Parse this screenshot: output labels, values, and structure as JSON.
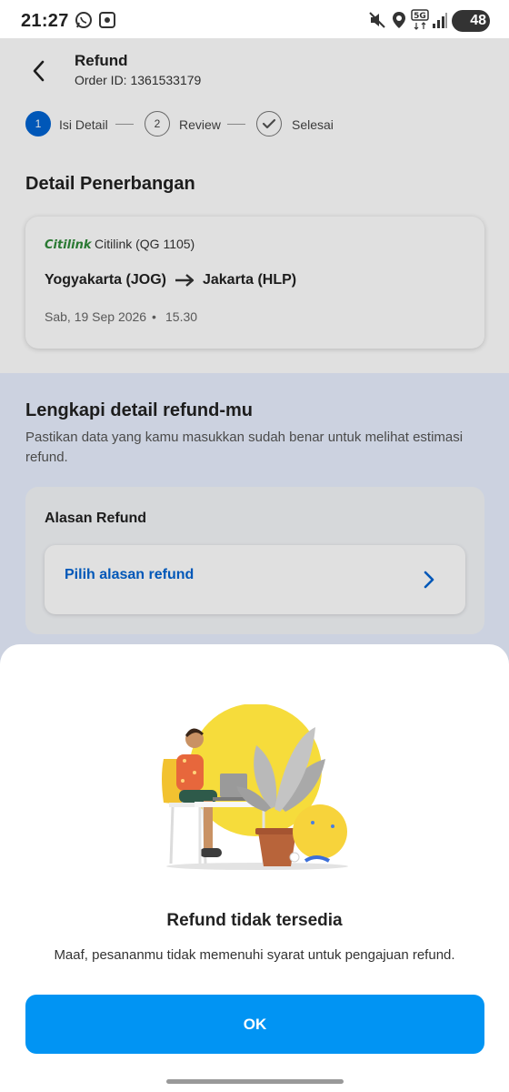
{
  "status_bar": {
    "time": "21:27",
    "battery": "48",
    "network": "5G",
    "icons": [
      "whatsapp-icon",
      "screenshot-icon",
      "mute-icon",
      "location-icon",
      "5g-icon",
      "signal-icon",
      "battery-icon"
    ]
  },
  "header": {
    "title": "Refund",
    "order_id": "Order ID: 1361533179"
  },
  "stepper": {
    "steps": [
      {
        "number": "1",
        "label": "Isi Detail",
        "state": "active"
      },
      {
        "number": "2",
        "label": "Review",
        "state": "inactive"
      },
      {
        "number": "",
        "label": "Selesai",
        "state": "check"
      }
    ]
  },
  "flight": {
    "section_title": "Detail Penerbangan",
    "airline_logo": "Citilink",
    "airline": "Citilink (QG 1105)",
    "origin": "Yogyakarta (JOG)",
    "destination": "Jakarta (HLP)",
    "date": "Sab, 19 Sep 2026",
    "separator": "•",
    "time": "15.30"
  },
  "refund": {
    "title": "Lengkapi detail refund-mu",
    "description": "Pastikan data yang kamu masukkan sudah benar untuk melihat estimasi refund.",
    "reason_title": "Alasan Refund",
    "reason_placeholder": "Pilih alasan refund"
  },
  "dialog": {
    "title": "Refund tidak tersedia",
    "message": "Maaf, pesananmu tidak memenuhi syarat untuk pengajuan refund.",
    "ok_label": "OK"
  },
  "colors": {
    "primary_button": "#0194f3",
    "step_active": "#0064d2",
    "link": "#0064d2",
    "refund_section_bg": "#e9f0ff",
    "illustration_sun": "#f6dc3b",
    "citilink_green": "#2f8a3a"
  }
}
